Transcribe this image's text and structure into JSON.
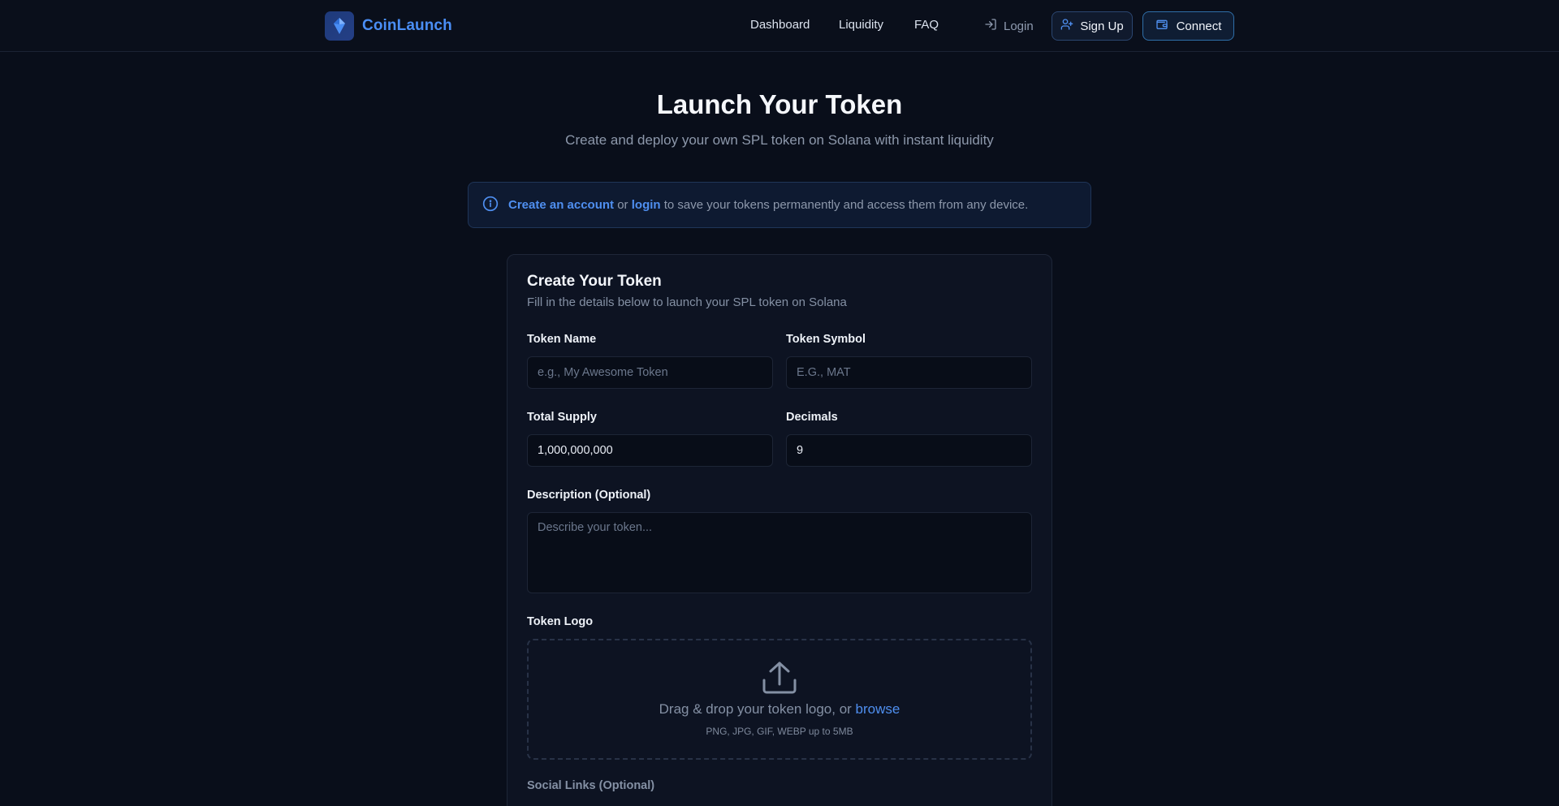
{
  "header": {
    "brand_name": "CoinLaunch",
    "nav": [
      "Dashboard",
      "Liquidity",
      "FAQ"
    ],
    "login_label": "Login",
    "signup_label": "Sign Up",
    "connect_label": "Connect"
  },
  "hero": {
    "title": "Launch Your Token",
    "subtitle": "Create and deploy your own SPL token on Solana with instant liquidity"
  },
  "notice": {
    "create_link": "Create an account",
    "or_text": "or",
    "login_link": "login",
    "rest_text": "to save your tokens permanently and access them from any device."
  },
  "form": {
    "title": "Create Your Token",
    "subtitle": "Fill in the details below to launch your SPL token on Solana",
    "token_name": {
      "label": "Token Name",
      "placeholder": "e.g., My Awesome Token",
      "value": ""
    },
    "token_symbol": {
      "label": "Token Symbol",
      "placeholder": "E.G., MAT",
      "value": ""
    },
    "total_supply": {
      "label": "Total Supply",
      "value": "1,000,000,000"
    },
    "decimals": {
      "label": "Decimals",
      "value": "9"
    },
    "description": {
      "label": "Description (Optional)",
      "placeholder": "Describe your token..."
    },
    "logo": {
      "label": "Token Logo",
      "drop_text": "Drag & drop your token logo, or",
      "browse_link": "browse",
      "hint": "PNG, JPG, GIF, WEBP up to 5MB"
    },
    "social_label": "Social Links (Optional)"
  },
  "colors": {
    "background": "#090e1a",
    "accent": "#4f8ff0",
    "card": "#0d1322"
  },
  "icons": [
    "diamond-logo-icon",
    "login-icon",
    "user-plus-icon",
    "wallet-icon",
    "info-icon",
    "upload-icon"
  ]
}
